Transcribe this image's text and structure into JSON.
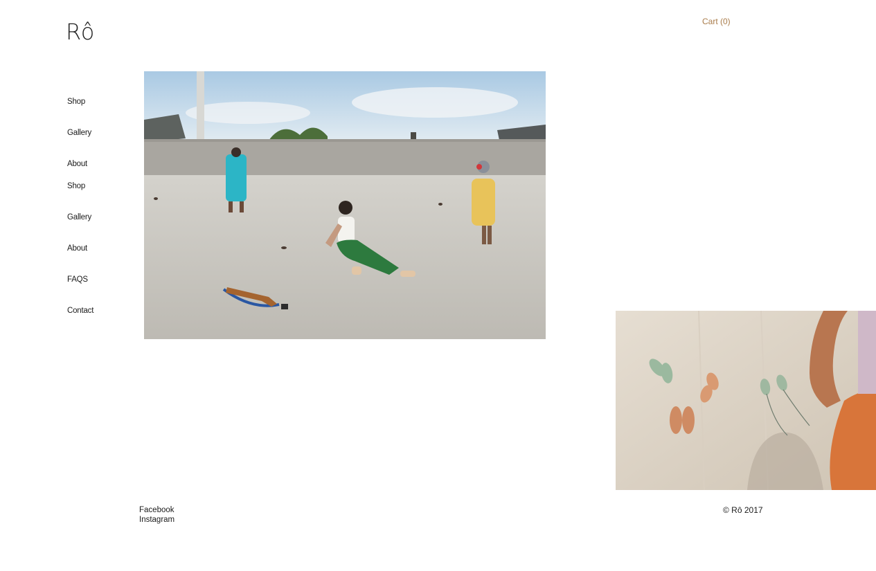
{
  "brand": {
    "logo": "Rô"
  },
  "header": {
    "cart_label": "Cart (0)",
    "cart_color": "#a97c4a"
  },
  "nav": {
    "items": [
      {
        "label": "Shop"
      },
      {
        "label": "Gallery"
      },
      {
        "label": "About"
      },
      {
        "label": "Shop"
      },
      {
        "label": "Gallery"
      },
      {
        "label": "About"
      },
      {
        "label": "FAQS"
      },
      {
        "label": "Contact"
      }
    ]
  },
  "gallery": {
    "images": [
      {
        "subject": "rooftop-scene"
      },
      {
        "subject": "sandals-on-concrete"
      }
    ]
  },
  "footer": {
    "social": [
      "Facebook",
      "Instagram"
    ],
    "copyright": "© Rô 2017"
  }
}
